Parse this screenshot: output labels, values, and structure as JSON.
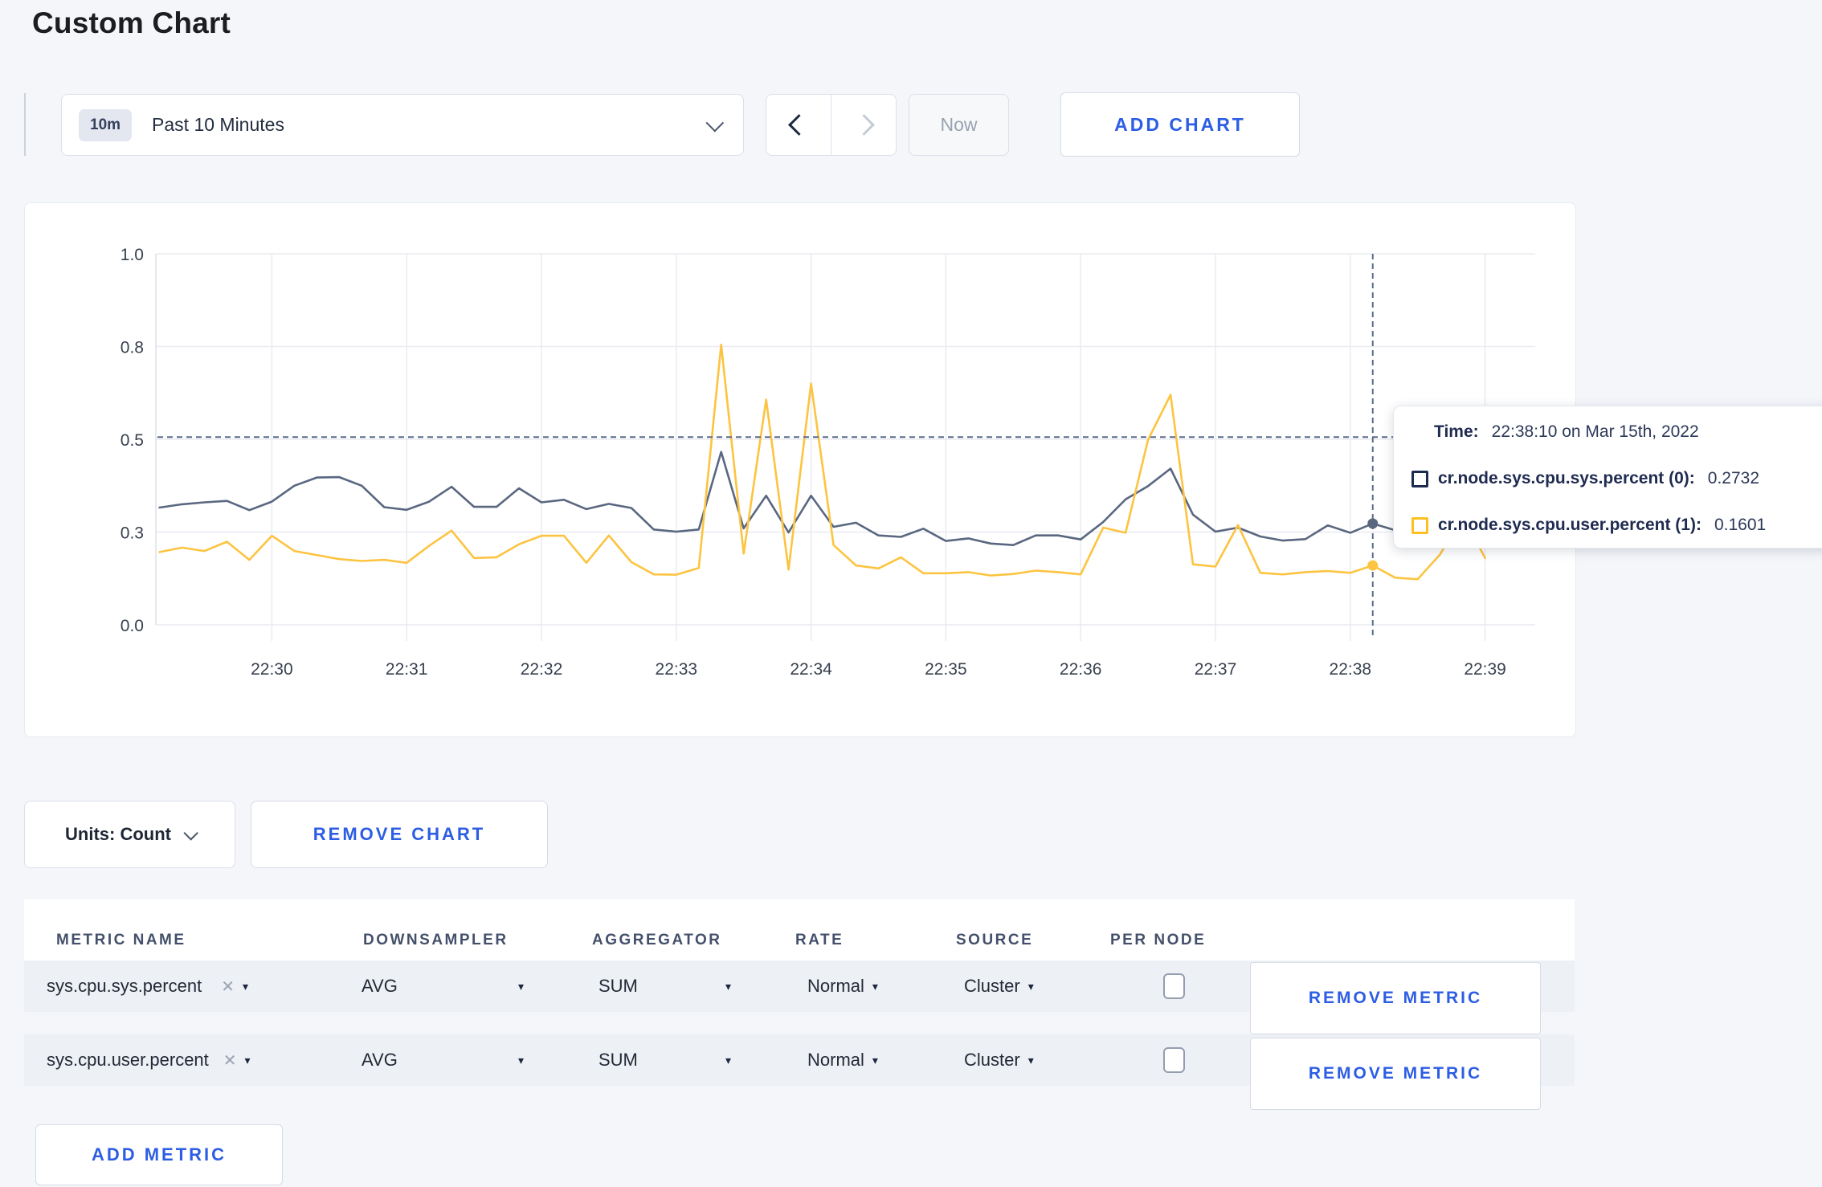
{
  "page": {
    "title": "Custom Chart"
  },
  "toolbar": {
    "range_badge": "10m",
    "range_label": "Past 10 Minutes",
    "now_label": "Now",
    "add_chart_label": "ADD CHART"
  },
  "icons": {
    "remove_x": "✕",
    "caret_down": "▾"
  },
  "chart_card": {
    "tooltip": {
      "time_label": "Time:",
      "time_value": "22:38:10 on Mar 15th, 2022",
      "series": [
        {
          "name": "cr.node.sys.cpu.sys.percent (0):",
          "value": "0.2732",
          "swatch_color": "#1e2b50"
        },
        {
          "name": "cr.node.sys.cpu.user.percent (1):",
          "value": "0.1601",
          "swatch_color": "#fdc020"
        }
      ]
    }
  },
  "chart_data": {
    "type": "line",
    "title": "",
    "x_tick_labels": [
      "22:30",
      "22:31",
      "22:32",
      "22:33",
      "22:34",
      "22:35",
      "22:36",
      "22:37",
      "22:38",
      "22:39"
    ],
    "y_tick_labels": [
      "0.0",
      "0.3",
      "0.5",
      "0.8",
      "1.0"
    ],
    "y_tick_values": [
      0,
      0.25,
      0.5,
      0.75,
      1.0
    ],
    "ylim": [
      0,
      1
    ],
    "x_start_offset_sec": -50,
    "x_step_sec": 10,
    "grid": true,
    "legend_position": "tooltip-only",
    "series": [
      {
        "name": "cr.node.sys.cpu.sys.percent",
        "color": "#5a6780",
        "values": [
          0.316,
          0.325,
          0.33,
          0.334,
          0.309,
          0.332,
          0.375,
          0.397,
          0.398,
          0.375,
          0.317,
          0.31,
          0.332,
          0.372,
          0.318,
          0.318,
          0.368,
          0.33,
          0.337,
          0.312,
          0.326,
          0.315,
          0.257,
          0.251,
          0.257,
          0.466,
          0.26,
          0.348,
          0.249,
          0.348,
          0.264,
          0.275,
          0.241,
          0.237,
          0.259,
          0.226,
          0.233,
          0.219,
          0.215,
          0.241,
          0.241,
          0.23,
          0.277,
          0.338,
          0.374,
          0.421,
          0.297,
          0.251,
          0.262,
          0.238,
          0.227,
          0.231,
          0.268,
          0.248,
          0.273,
          0.255,
          0.26,
          0.248,
          0.262,
          0.27
        ]
      },
      {
        "name": "cr.node.sys.cpu.user.percent",
        "color": "#fcc440",
        "values": [
          0.196,
          0.208,
          0.199,
          0.224,
          0.175,
          0.24,
          0.199,
          0.188,
          0.177,
          0.172,
          0.175,
          0.167,
          0.213,
          0.254,
          0.18,
          0.182,
          0.217,
          0.24,
          0.24,
          0.167,
          0.241,
          0.169,
          0.136,
          0.135,
          0.153,
          0.755,
          0.192,
          0.607,
          0.149,
          0.65,
          0.215,
          0.16,
          0.152,
          0.182,
          0.139,
          0.139,
          0.142,
          0.133,
          0.137,
          0.146,
          0.142,
          0.136,
          0.262,
          0.248,
          0.499,
          0.62,
          0.163,
          0.157,
          0.269,
          0.14,
          0.136,
          0.142,
          0.145,
          0.14,
          0.16,
          0.127,
          0.123,
          0.19,
          0.295,
          0.18
        ]
      }
    ],
    "hover": {
      "index": 54,
      "time": "22:38:10",
      "value_line": 0.506,
      "values": {
        "sys": 0.2732,
        "user": 0.1601
      }
    }
  },
  "chart_footer": {
    "units_label": "Units: Count",
    "remove_chart_label": "REMOVE CHART"
  },
  "metrics_table": {
    "headers": [
      "METRIC NAME",
      "DOWNSAMPLER",
      "AGGREGATOR",
      "RATE",
      "SOURCE",
      "PER NODE"
    ],
    "rows": [
      {
        "metric": "sys.cpu.sys.percent",
        "downsampler": "AVG",
        "aggregator": "SUM",
        "rate": "Normal",
        "source": "Cluster",
        "per_node_checked": false,
        "remove_label": "REMOVE METRIC"
      },
      {
        "metric": "sys.cpu.user.percent",
        "downsampler": "AVG",
        "aggregator": "SUM",
        "rate": "Normal",
        "source": "Cluster",
        "per_node_checked": false,
        "remove_label": "REMOVE METRIC"
      }
    ],
    "add_metric_label": "ADD METRIC"
  }
}
